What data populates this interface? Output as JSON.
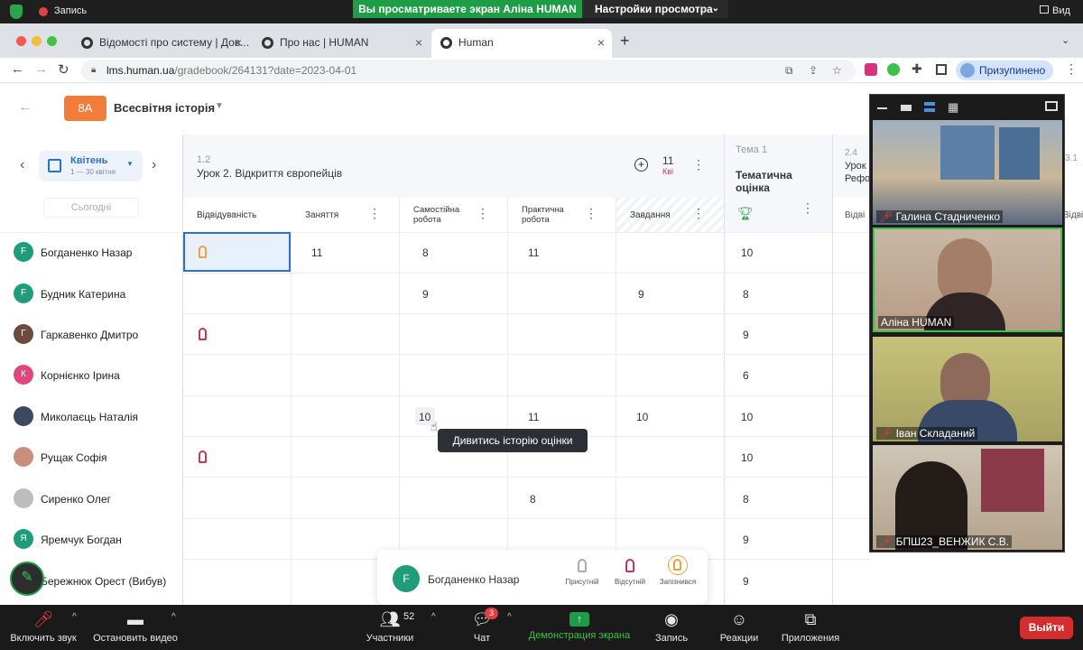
{
  "zoom": {
    "recording_label": "Запись",
    "share_banner": "Вы просматриваете экран Аліна HUMAN",
    "view_options": "Настройки просмотра",
    "view_label": "Вид",
    "bottom": {
      "mute": "Включить звук",
      "video": "Остановить видео",
      "participants": "Участники",
      "participants_count": "52",
      "chat": "Чат",
      "chat_badge": "3",
      "share": "Демонстрация экрана",
      "record": "Запись",
      "reactions": "Реакции",
      "apps": "Приложения",
      "leave": "Выйти"
    }
  },
  "browser": {
    "tabs": [
      {
        "title": "Відомості про систему | Дов..."
      },
      {
        "title": "Про нас | HUMAN"
      },
      {
        "title": "Human"
      }
    ],
    "url_host": "lms.human.ua",
    "url_path": "/gradebook/264131?date=2023-04-01",
    "profile_label": "Призупинено"
  },
  "app": {
    "class_badge": "8А",
    "subject": "Всесвітня історія",
    "month": "Квітень",
    "month_range": "1 — 30 квітня",
    "today_button": "Сьогодні",
    "lesson_number": "1.2",
    "lesson_title": "Урок 2. Відкриття європейців",
    "lesson_count": "11",
    "lesson_count_label": "Кві",
    "theme_label": "Тема 1",
    "thematic_title": "Тематична оцінка",
    "next_lesson_number": "2.4",
    "next_lesson_title_1": "Урок",
    "next_lesson_title_2": "Рефо",
    "next_att_header": "Відві",
    "far_right_num": "3.1",
    "far_right_header": "Відві",
    "columns": [
      "Відвідуваність",
      "Заняття",
      "Самостійна робота",
      "Практична робота",
      "Завдання"
    ],
    "students": [
      {
        "initial": "F",
        "color": "#1f9c7a",
        "name": "Богданенко Назар",
        "att": "late",
        "zan": "11",
        "sam": "8",
        "prak": "11",
        "zav": "",
        "tem": "10"
      },
      {
        "initial": "F",
        "color": "#1f9c7a",
        "name": "Будник Катерина",
        "att": "",
        "zan": "",
        "sam": "9",
        "prak": "",
        "zav": "9",
        "tem": "8"
      },
      {
        "initial": "Г",
        "color": "#6d4a3d",
        "name": "Гаркавенко Дмитро",
        "att": "absent",
        "zan": "",
        "sam": "",
        "prak": "",
        "zav": "",
        "tem": "9"
      },
      {
        "initial": "К",
        "color": "#e0457b",
        "name": "Корнієнко Ірина",
        "att": "",
        "zan": "",
        "sam": "",
        "prak": "",
        "zav": "",
        "tem": "6"
      },
      {
        "initial": "",
        "color": "#3b4a5e",
        "name": "Миколаєць Наталія",
        "att": "",
        "zan": "",
        "sam": "10",
        "prak": "11",
        "zav": "10",
        "tem": "10"
      },
      {
        "initial": "",
        "color": "#c98f7a",
        "name": "Рущак Софія",
        "att": "absent",
        "zan": "",
        "sam": "",
        "prak": "",
        "zav": "",
        "tem": "10"
      },
      {
        "initial": "",
        "color": "#bdbdbd",
        "name": "Сиренко Олег",
        "att": "",
        "zan": "",
        "sam": "",
        "prak": "8",
        "zav": "",
        "tem": "8"
      },
      {
        "initial": "Я",
        "color": "#1f9c7a",
        "name": "Яремчук Богдан",
        "att": "",
        "zan": "",
        "sam": "",
        "prak": "",
        "zav": "",
        "tem": "9"
      },
      {
        "initial": "",
        "color": "#555555",
        "name": "Бережнюк Орест (Вибув)",
        "att": "",
        "zan": "",
        "sam": "",
        "prak": "",
        "zav": "",
        "tem": "9"
      }
    ],
    "tooltip": "Дивитись історію оцінки",
    "popup": {
      "student_initial": "F",
      "student_name": "Богданенко Назар",
      "present": "Присутній",
      "absent": "Відсутній",
      "late": "Запізнився"
    }
  },
  "video": {
    "participants": [
      {
        "name": "Галина Стадниченко",
        "muted": true
      },
      {
        "name": "Аліна HUMAN",
        "muted": false
      },
      {
        "name": "Іван Складаний",
        "muted": true
      },
      {
        "name": "БПШ23_ВЕНЖИК С.В.",
        "muted": true
      }
    ]
  },
  "colors": {
    "accent_green": "#1f9c46",
    "badge_orange": "#f27d3a",
    "absent_red": "#c0395a",
    "late_orange": "#f0a03c",
    "leave_red": "#d32d2d",
    "link_blue": "#2a6fd6"
  }
}
